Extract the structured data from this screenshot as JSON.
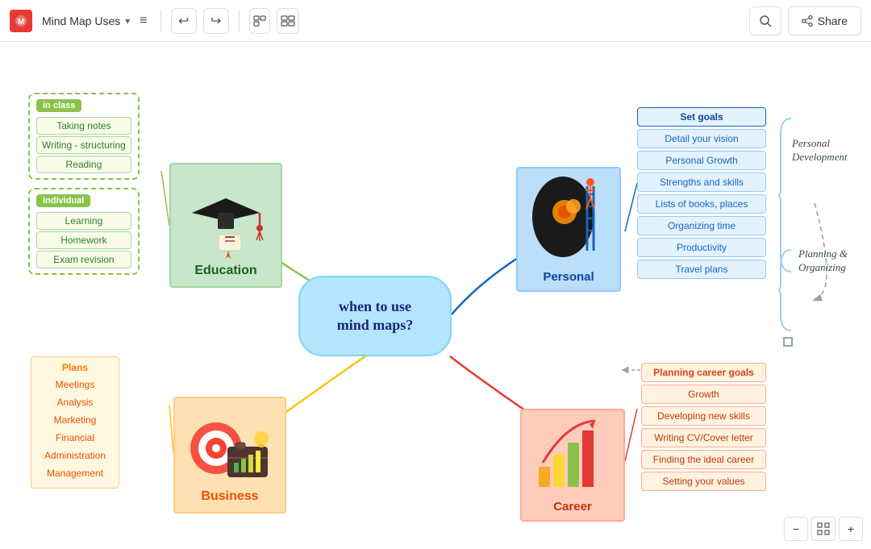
{
  "topbar": {
    "logo": "M",
    "title": "Mind Map Uses",
    "share_label": "Share",
    "search_icon": "search",
    "undo_icon": "←",
    "redo_icon": "→"
  },
  "center": {
    "text": "when to use\nmind maps?"
  },
  "education": {
    "label": "Education",
    "in_class_label": "in class",
    "in_class_items": [
      "Taking notes",
      "Writing - structuring",
      "Reading"
    ],
    "individual_label": "individual",
    "individual_items": [
      "Learning",
      "Homework",
      "Exam revision"
    ]
  },
  "business": {
    "label": "Business",
    "plans_label": "Plans",
    "items": [
      "Meetings",
      "Analysis",
      "Marketing",
      "Financial",
      "Administration",
      "Management"
    ]
  },
  "personal": {
    "label": "Personal",
    "items": [
      "Set goals",
      "Detail your vision",
      "Personal Growth",
      "Strengths and skills",
      "Lists of books, places",
      "Organizing time",
      "Productivity",
      "Travel plans"
    ],
    "personal_development_label": "Personal\nDevelopment",
    "planning_label": "Planning &\nOrganizing"
  },
  "career": {
    "label": "Career",
    "items": [
      "Planning career goals",
      "Growth",
      "Developing new skills",
      "Writing CV/Cover letter",
      "Finding the ideal career",
      "Setting  your values"
    ]
  }
}
